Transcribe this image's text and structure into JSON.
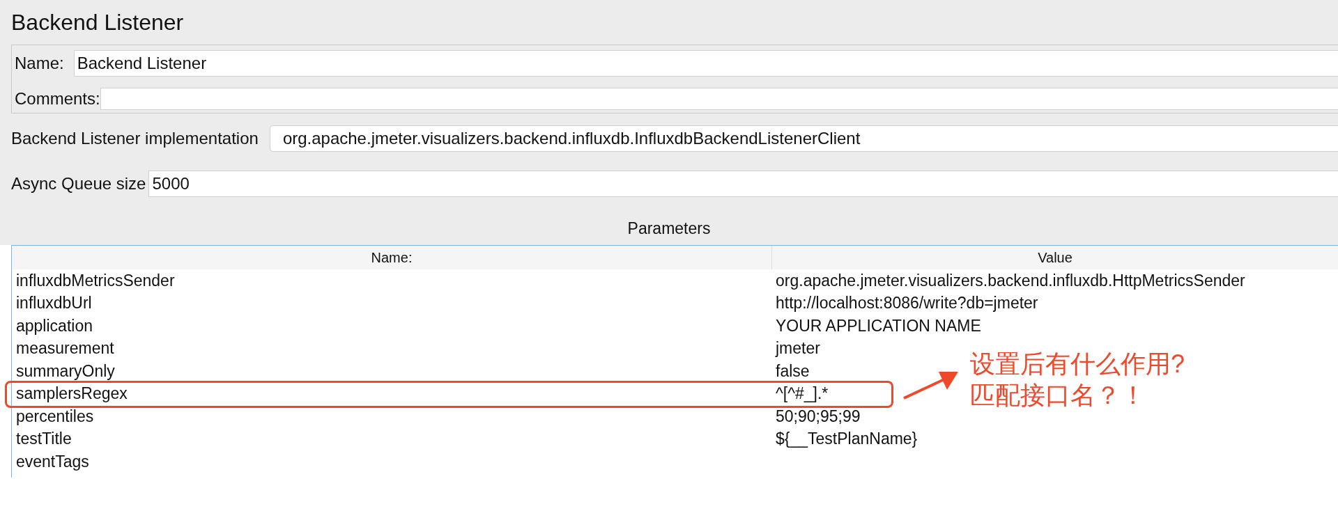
{
  "title": "Backend Listener",
  "name_field": {
    "label": "Name:",
    "value": "Backend Listener"
  },
  "comments_field": {
    "label": "Comments:"
  },
  "implementation": {
    "label": "Backend Listener implementation",
    "value": "org.apache.jmeter.visualizers.backend.influxdb.InfluxdbBackendListenerClient"
  },
  "queue_size": {
    "label": "Async Queue size",
    "value": "5000"
  },
  "parameters": {
    "title": "Parameters",
    "columns": [
      "Name:",
      "Value"
    ],
    "rows": [
      {
        "name": "influxdbMetricsSender",
        "value": "org.apache.jmeter.visualizers.backend.influxdb.HttpMetricsSender",
        "highlighted": false
      },
      {
        "name": "influxdbUrl",
        "value": "http://localhost:8086/write?db=jmeter",
        "highlighted": false
      },
      {
        "name": "application",
        "value": "YOUR APPLICATION NAME",
        "highlighted": false
      },
      {
        "name": "measurement",
        "value": "jmeter",
        "highlighted": false
      },
      {
        "name": "summaryOnly",
        "value": "false",
        "highlighted": false
      },
      {
        "name": "samplersRegex",
        "value": "^[^#_].*",
        "highlighted": true
      },
      {
        "name": "percentiles",
        "value": "50;90;95;99",
        "highlighted": false
      },
      {
        "name": "testTitle",
        "value": "${__TestPlanName}",
        "highlighted": false
      },
      {
        "name": "eventTags",
        "value": "",
        "highlighted": false
      }
    ]
  },
  "annotation": {
    "lines": [
      "设置后有什么作用?",
      "匹配接口名？！"
    ]
  }
}
